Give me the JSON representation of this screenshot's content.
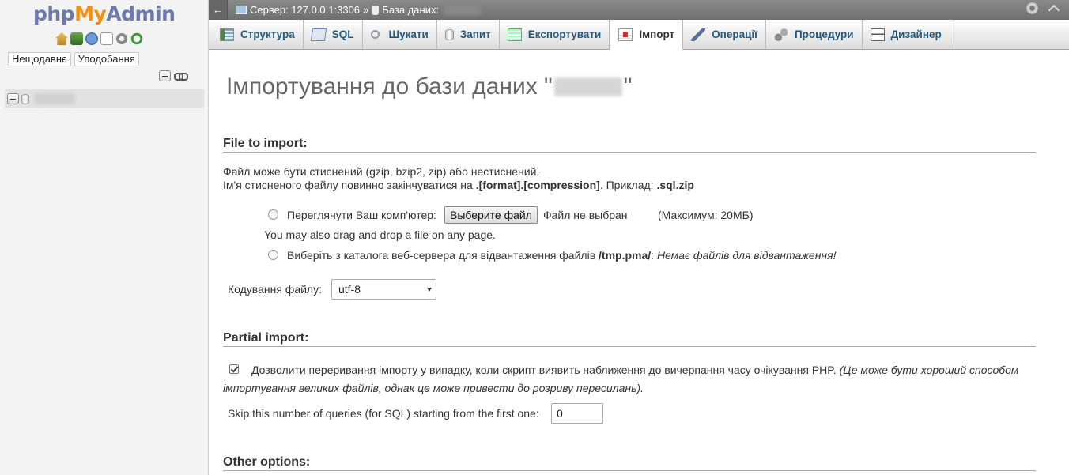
{
  "nav": {
    "logo": {
      "part1": "php",
      "part2": "My",
      "part3": "Admin"
    },
    "icons": [
      "home-icon",
      "exit-icon",
      "help-icon",
      "docs-icon",
      "settings-icon",
      "reload-icon"
    ],
    "tabs": {
      "recent": "Нещодавнє",
      "favorites": "Уподобання"
    }
  },
  "topbar": {
    "server_label": "Сервер: 127.0.0.1:3306",
    "separator": "»",
    "database_label": "База даних:"
  },
  "tabs": [
    {
      "label": "Структура",
      "icon": "structure-icon"
    },
    {
      "label": "SQL",
      "icon": "sql-icon"
    },
    {
      "label": "Шукати",
      "icon": "search-icon"
    },
    {
      "label": "Запит",
      "icon": "query-icon"
    },
    {
      "label": "Експортувати",
      "icon": "export-icon"
    },
    {
      "label": "Імпорт",
      "icon": "import-icon",
      "active": true
    },
    {
      "label": "Операції",
      "icon": "operations-icon"
    },
    {
      "label": "Процедури",
      "icon": "procedures-icon"
    },
    {
      "label": "Дизайнер",
      "icon": "designer-icon"
    }
  ],
  "page": {
    "title_prefix": "Імпортування до бази даних \"",
    "title_suffix": "\""
  },
  "file_section": {
    "legend": "File to import:",
    "line1": "Файл може бути стиснений (gzip, bzip2, zip) або нестиснений.",
    "line2_prefix": "Ім'я стисненого файлу повинно закінчуватися на ",
    "line2_format": ".[format].[compression]",
    "line2_mid": ". Приклад: ",
    "line2_example": ".sql.zip",
    "browse_label": "Переглянути Ваш комп'ютер:",
    "choose_button": "Выберите файл",
    "no_file": "Файл не выбран",
    "max_size": "(Максимум: 20МБ)",
    "drag_hint": "You may also drag and drop a file on any page.",
    "webserver_label": "Виберіть з каталога веб-сервера для відвантаження файлів ",
    "webserver_dir": "/tmp.pma/",
    "webserver_colon": ":",
    "no_files_msg": "Немає файлів для відвантаження!",
    "charset_label": "Кодування файлу:",
    "charset_value": "utf-8"
  },
  "partial_section": {
    "legend": "Partial import:",
    "allow_interrupt_label": "Дозволити переривання імпорту у випадку, коли скрипт виявить наближення до вичерпання часу очікування PHP.",
    "allow_interrupt_hint_1": "(Це може бути хороший способом",
    "allow_interrupt_hint_2": "імпортування великих файлів, однак це може привести до розриву пересилань).",
    "allow_interrupt_checked": true,
    "skip_label": "Skip this number of queries (for SQL) starting from the first one:",
    "skip_value": "0"
  },
  "other_section": {
    "legend": "Other options:"
  }
}
